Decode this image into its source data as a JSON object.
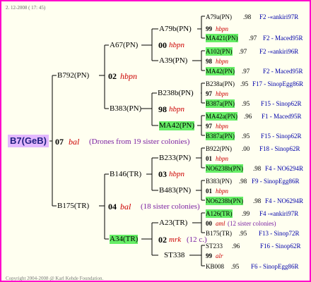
{
  "header": {
    "date": "2. 12-2008 ( 17: 45)"
  },
  "footer": {
    "copyright": "Copyright 2004-2008 @ Karl Kehde Foundation."
  },
  "root": {
    "label": "B7(GeB)",
    "gen_number": "07",
    "gen_code": "bal",
    "note": "(Drones from 19 sister colonies)"
  },
  "gen2": {
    "upper": {
      "label": "B792(PN)",
      "gen_number": "02",
      "gen_code": "hbpn"
    },
    "lower": {
      "label": "B175(TR)",
      "gen_number": "04",
      "gen_code": "bal",
      "note": "(18 sister colonies)"
    }
  },
  "gen3": {
    "a67": {
      "label": "A67(PN)",
      "gen_number": "00",
      "gen_code": "hbpn"
    },
    "b383": {
      "label": "B383(PN)",
      "gen_number": "98",
      "gen_code": "hbpn"
    },
    "b146": {
      "label": "B146(TR)",
      "gen_number": "03",
      "gen_code": "hbpn"
    },
    "a34": {
      "label": "A34(TR)",
      "gen_number": "02",
      "gen_code": "mrk",
      "note": "(12 c.)"
    }
  },
  "gen4": {
    "a79b": {
      "label": "A79b(PN)",
      "gen_number": "99",
      "gen_code": "hbpn"
    },
    "a39": {
      "label": "A39(PN)",
      "gen_number": "98",
      "gen_code": "hbpn"
    },
    "b238b": {
      "label": "B238b(PN)",
      "gen_number": "97",
      "gen_code": "hbpn"
    },
    "ma42": {
      "label": "MA42(PN)",
      "gen_number": "97",
      "gen_code": "hbpn"
    },
    "b233": {
      "label": "B233(PN)",
      "gen_number": "01",
      "gen_code": "hbpn"
    },
    "b483": {
      "label": "B483(PN)",
      "gen_number": "01",
      "gen_code": "hbpn"
    },
    "a23": {
      "label": "A23(TR)",
      "gen_number": "00",
      "gen_code": "aml",
      "note": "(12 sister colonies)"
    },
    "st338": {
      "label": "ST338",
      "gen_number": "99",
      "gen_code": "alr"
    }
  },
  "gen5": [
    {
      "label": "A79a(PN)",
      "year": ".98",
      "source": "F2 -«ankiri97R"
    },
    {
      "label": "MA421(PN)",
      "year": ".97",
      "source": "F2 - Maced95R"
    },
    {
      "label": "A102(PN)",
      "year": ".97",
      "source": "F2 -«ankiri96R"
    },
    {
      "label": "MA42(PN)",
      "year": ".97",
      "source": "F2 - Maced95R"
    },
    {
      "label": "B238a(PN)",
      "year": ".95",
      "source": "F17 - SinopEgg86R"
    },
    {
      "label": "B387a(PN)",
      "year": ".95",
      "source": "F15 - Sinop62R"
    },
    {
      "label": "MA42a(PN)",
      "year": ".96",
      "source": "F1 - Maced95R"
    },
    {
      "label": "B387a(PN)",
      "year": ".95",
      "source": "F15 - Sinop62R"
    },
    {
      "label": "B922(PN)",
      "year": ".00",
      "source": "F18 - Sinop62R"
    },
    {
      "label": "NO6238b(PN)",
      "year": ".98",
      "source": "F4 - NO6294R"
    },
    {
      "label": "B383(PN)",
      "year": ".98",
      "source": "F9 - SinopEgg86R"
    },
    {
      "label": "NO6238b(PN)",
      "year": ".98",
      "source": "F4 - NO6294R"
    },
    {
      "label": "A126(TR)",
      "year": ".99",
      "source": "F4 -«ankiri97R"
    },
    {
      "label": "B175(TR)",
      "year": ".95",
      "source": "F13 - Sinop72R"
    },
    {
      "label": "ST233",
      "year": ".96",
      "source": "F16 - Sinop62R"
    },
    {
      "label": "KB008",
      "year": ".95",
      "source": "F6 - SinopEgg86R"
    }
  ]
}
